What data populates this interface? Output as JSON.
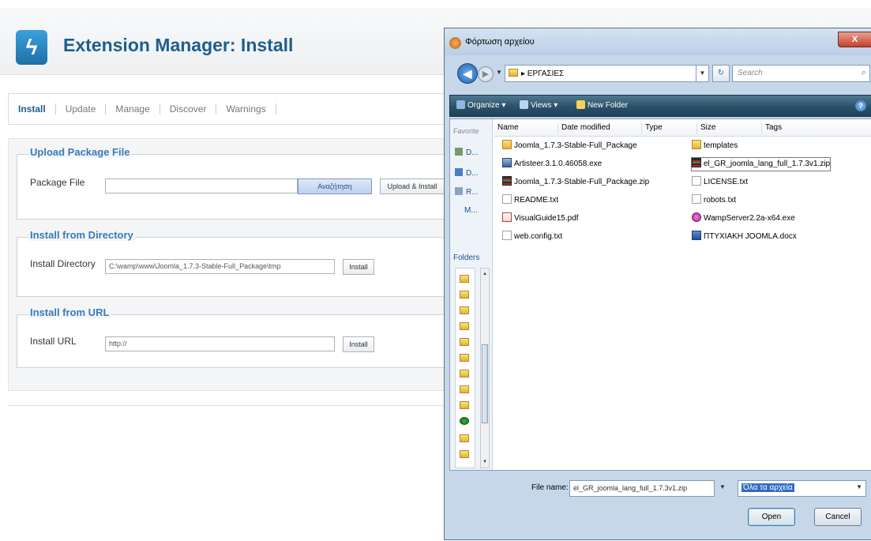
{
  "page": {
    "title": "Extension Manager: Install",
    "logo_glyph": "ϟ",
    "tabs": [
      {
        "label": "Install",
        "active": true
      },
      {
        "label": "Update",
        "active": false
      },
      {
        "label": "Manage",
        "active": false
      },
      {
        "label": "Discover",
        "active": false
      },
      {
        "label": "Warnings",
        "active": false
      }
    ],
    "upload": {
      "legend": "Upload Package File",
      "label": "Package File",
      "value": "",
      "browse_label": "Αναζήτηση",
      "button_label": "Upload & Install"
    },
    "directory": {
      "legend": "Install from Directory",
      "label": "Install Directory",
      "value": "C:\\wamp\\www\\Joomla_1.7.3-Stable-Full_Package\\tmp",
      "button_label": "Install"
    },
    "url": {
      "legend": "Install from URL",
      "label": "Install URL",
      "value": "http://",
      "button_label": "Install"
    }
  },
  "dialog": {
    "title": "Φόρτωση αρχείου",
    "close_glyph": "X",
    "breadcrumb": "▸ ΕΡΓΑΣΙΕΣ",
    "search_placeholder": "Search",
    "toolbar": {
      "organize": "Organize ▾",
      "views": "Views ▾",
      "new_folder": "New Folder"
    },
    "nav_pane": {
      "favorites_label": "Favorite",
      "links": [
        "D...",
        "D...",
        "R...",
        "M..."
      ],
      "folders_label": "Folders"
    },
    "columns": [
      "Name",
      "Date modified",
      "Type",
      "Size",
      "Tags"
    ],
    "files_left": [
      {
        "name": "Joomla_1.7.3-Stable-Full_Package",
        "icon": "folder-icon"
      },
      {
        "name": "Artisteer.3.1.0.46058.exe",
        "icon": "exe-icon"
      },
      {
        "name": "Joomla_1.7.3-Stable-Full_Package.zip",
        "icon": "zip-icon"
      },
      {
        "name": "README.txt",
        "icon": "text-file-icon"
      },
      {
        "name": "VisualGuide15.pdf",
        "icon": "pdf-icon"
      },
      {
        "name": "web.config.txt",
        "icon": "text-file-icon"
      }
    ],
    "files_right": [
      {
        "name": "templates",
        "icon": "folder-icon"
      },
      {
        "name": "el_GR_joomla_lang_full_1.7.3v1.zip",
        "icon": "zip-icon",
        "selected": true
      },
      {
        "name": "LICENSE.txt",
        "icon": "text-file-icon"
      },
      {
        "name": "robots.txt",
        "icon": "text-file-icon"
      },
      {
        "name": "WampServer2.2a-x64.exe",
        "icon": "wamp-icon"
      },
      {
        "name": "ΠΤΥΧΙΑΚΗ JOOMLA.docx",
        "icon": "word-doc-icon"
      }
    ],
    "filename_label": "File name:",
    "filename_value": "el_GR_joomla_lang_full_1.7.3v1.zip",
    "filetype_value": "Όλα τα αρχεία",
    "open_label": "Open",
    "cancel_label": "Cancel"
  }
}
